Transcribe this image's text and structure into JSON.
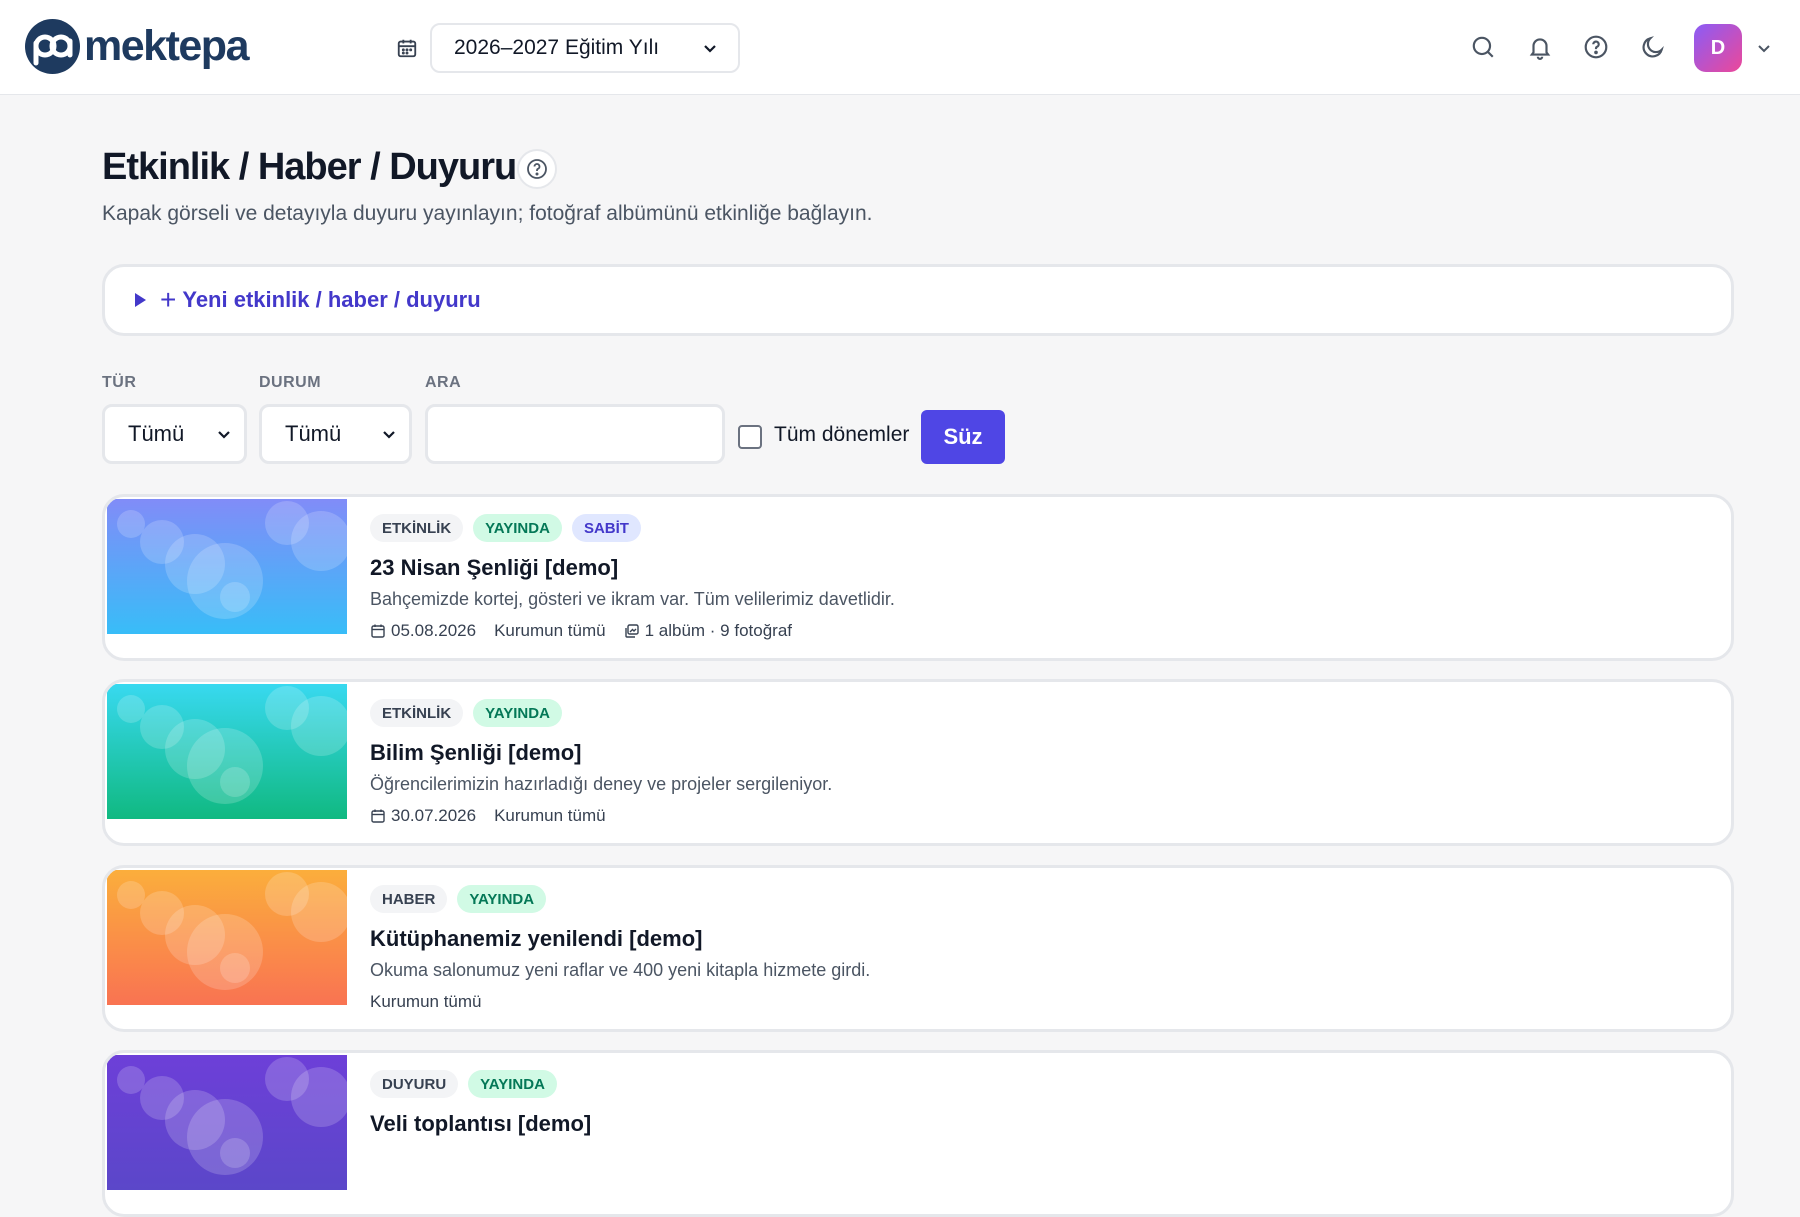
{
  "app": {
    "logo_text": "mektepa",
    "user_initial": "D"
  },
  "year_select": {
    "value": "2026–2027 Eğitim Yılı"
  },
  "page": {
    "title": "Etkinlik / Haber / Duyuru",
    "subtitle": "Kapak görseli ve detayıyla duyuru yayınlayın; fotoğraf albümünü etkinliğe bağlayın.",
    "new_item_label": "Yeni etkinlik / haber / duyuru"
  },
  "filters": {
    "type_label": "TÜR",
    "type_value": "Tümü",
    "status_label": "DURUM",
    "status_value": "Tümü",
    "search_label": "ARA",
    "search_value": "",
    "all_periods_label": "Tüm dönemler",
    "submit_label": "Süz"
  },
  "items": [
    {
      "type": "ETKİNLİK",
      "status": "YAYINDA",
      "pinned": "SABİT",
      "title": "23 Nisan Şenliği [demo]",
      "description": "Bahçemizde kortej, gösteri ve ikram var. Tüm velilerimiz davetlidir.",
      "date": "05.08.2026",
      "audience": "Kurumun tümü",
      "album": "1 albüm · 9 fotoğraf",
      "gradient": [
        "#818cf8",
        "#38bdf8"
      ]
    },
    {
      "type": "ETKİNLİK",
      "status": "YAYINDA",
      "title": "Bilim Şenliği [demo]",
      "description": "Öğrencilerimizin hazırladığı deney ve projeler sergileniyor.",
      "date": "30.07.2026",
      "audience": "Kurumun tümü",
      "gradient": [
        "#38d9f0",
        "#10b981"
      ]
    },
    {
      "type": "HABER",
      "status": "YAYINDA",
      "title": "Kütüphanemiz yenilendi [demo]",
      "description": "Okuma salonumuz yeni raflar ve 400 yeni kitapla hizmete girdi.",
      "audience": "Kurumun tümü",
      "gradient": [
        "#fbae3c",
        "#f97352"
      ]
    },
    {
      "type": "DUYURU",
      "status": "YAYINDA",
      "title": "Veli toplantısı [demo]",
      "gradient": [
        "#6d3fd8",
        "#5b47c9"
      ]
    }
  ]
}
